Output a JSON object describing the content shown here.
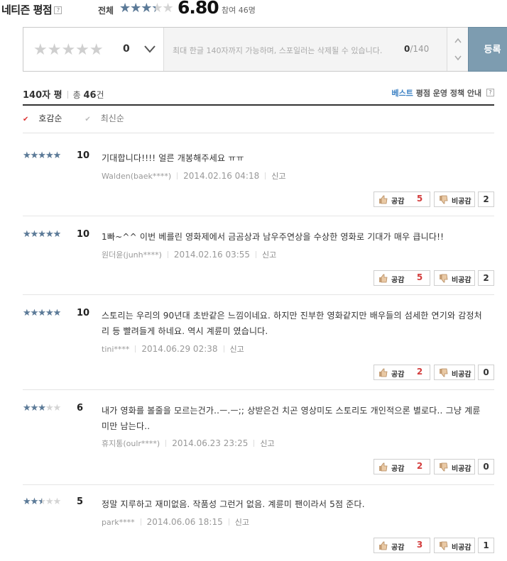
{
  "header": {
    "title": "네티즌 평점",
    "help": "?",
    "total_label": "전체",
    "rating_fraction": 0.68,
    "score": "6.80",
    "participants": "참여 46명"
  },
  "input": {
    "score": "0",
    "placeholder": "최대 한글 140자까지 가능하며, 스포일러는 삭제될 수 있습니다.",
    "char_count": "0",
    "char_max": "/140",
    "submit_label": "등록"
  },
  "summary": {
    "label": "140자 평",
    "total_prefix": "총 ",
    "total_count": "46",
    "total_suffix": "건",
    "policy_best": "베스트",
    "policy_text": " 평점 운영 정책 안내 ",
    "policy_help": "?"
  },
  "sort": {
    "options": [
      {
        "label": "호감순",
        "selected": true
      },
      {
        "label": "최신순",
        "selected": false
      }
    ]
  },
  "votes": {
    "like_label": "공감",
    "dislike_label": "비공감"
  },
  "reviews": [
    {
      "score": "10",
      "rating_fraction": 1.0,
      "text": "기대합니다!!!! 얼른 개봉해주세요 ㅠㅠ",
      "author": "Walden(baek****)",
      "date": "2014.02.16 04:18",
      "report": "신고",
      "likes": "5",
      "dislikes": "2"
    },
    {
      "score": "10",
      "rating_fraction": 1.0,
      "text": "1빠~^^ 이번 베를린 영화제에서 금곰상과 남우주연상을 수상한 영화로 기대가 매우 큽니다!!",
      "author": "원더윤(junh****)",
      "date": "2014.02.16 03:55",
      "report": "신고",
      "likes": "5",
      "dislikes": "2"
    },
    {
      "score": "10",
      "rating_fraction": 1.0,
      "text": "스토리는 우리의 90년대 초반같은 느낌이네요. 하지만 진부한 영화같지만 배우들의 섬세한 연기와 감정처리 등 빨려들게 하네요. 역시 계륜미 였습니다.",
      "author": "tini****",
      "date": "2014.06.29 02:38",
      "report": "신고",
      "likes": "2",
      "dislikes": "0"
    },
    {
      "score": "6",
      "rating_fraction": 0.6,
      "text": "내가 영화를 볼줄을 모르는건가..ㅡ.ㅡ;; 상받은건 치곤 영상미도 스토리도 개인적으론 별로다.. 그냥 계륜미만 남는다..",
      "author": "휴지통(oulr****)",
      "date": "2014.06.23 23:25",
      "report": "신고",
      "likes": "2",
      "dislikes": "0"
    },
    {
      "score": "5",
      "rating_fraction": 0.5,
      "text": "정말 지루하고 재미없음. 작품성 그런거 없음. 계륜미 팬이라서 5점 준다.",
      "author": "park****",
      "date": "2014.06.06 18:15",
      "report": "신고",
      "likes": "3",
      "dislikes": "1"
    }
  ],
  "colors": {
    "star_filled": "#5b7a98",
    "star_empty": "#d4d4d4",
    "submit_bg": "#7d9cb0",
    "like_count": "#d33d3d",
    "best_link": "#3d82c4"
  }
}
